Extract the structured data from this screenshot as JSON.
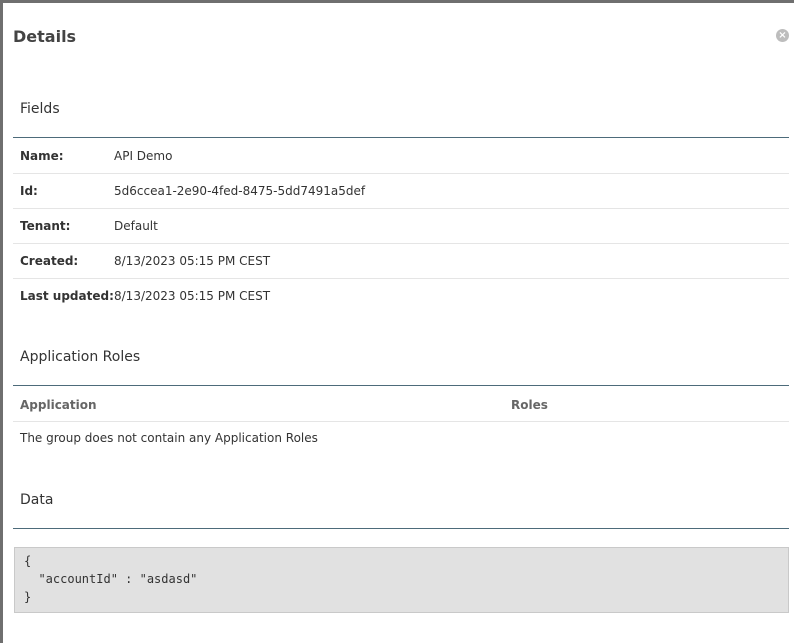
{
  "dialog": {
    "title": "Details",
    "close_icon": "close-circle-icon"
  },
  "fields": {
    "heading": "Fields",
    "rows": [
      {
        "label": "Name:",
        "value": "API Demo"
      },
      {
        "label": "Id:",
        "value": "5d6ccea1-2e90-4fed-8475-5dd7491a5def"
      },
      {
        "label": "Tenant:",
        "value": "Default"
      },
      {
        "label": "Created:",
        "value": "8/13/2023 05:15 PM CEST"
      },
      {
        "label": "Last updated:",
        "value": "8/13/2023 05:15 PM CEST"
      }
    ]
  },
  "application_roles": {
    "heading": "Application Roles",
    "columns": [
      "Application",
      "Roles"
    ],
    "empty_text": "The group does not contain any Application Roles"
  },
  "data_section": {
    "heading": "Data",
    "lines": [
      "{",
      "  \"accountId\" : \"asdasd\"",
      "}"
    ]
  }
}
